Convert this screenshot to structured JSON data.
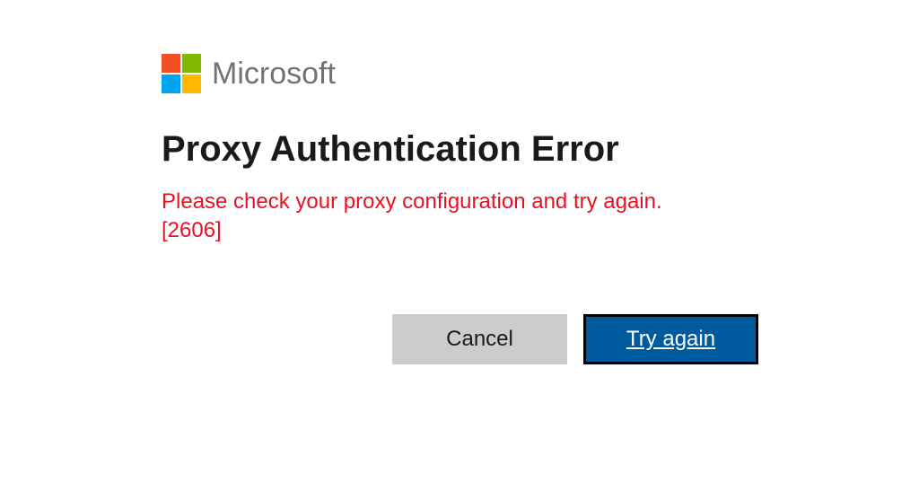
{
  "brand": {
    "name": "Microsoft"
  },
  "dialog": {
    "title": "Proxy Authentication Error",
    "message": "Please check your proxy configuration and try again. [2606]"
  },
  "actions": {
    "cancel_label": "Cancel",
    "retry_label": "Try again"
  },
  "colors": {
    "error_text": "#e81123",
    "primary_button": "#005a9e",
    "secondary_button": "#cccccc"
  }
}
